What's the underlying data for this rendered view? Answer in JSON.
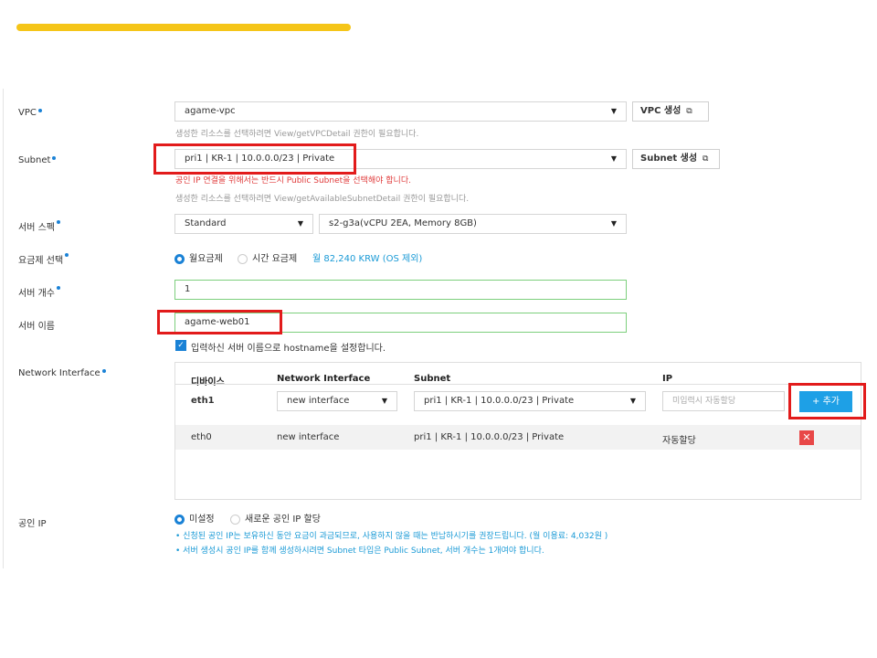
{
  "form": {
    "vpc": {
      "label": "VPC",
      "value": "agame-vpc",
      "button": "VPC 생성",
      "hint": "생성한 리소스를 선택하려면 View/getVPCDetail 권한이 필요합니다."
    },
    "subnet": {
      "label": "Subnet",
      "value": "pri1 | KR-1 | 10.0.0.0/23 | Private",
      "button": "Subnet 생성",
      "error": "공인 IP 연결을 위해서는 반드시 Public Subnet을 선택해야 합니다.",
      "hint": "생성한 리소스를 선택하려면 View/getAvailableSubnetDetail 권한이 필요합니다."
    },
    "spec": {
      "label": "서버 스펙",
      "type_value": "Standard",
      "size_value": "s2-g3a(vCPU 2EA, Memory 8GB)"
    },
    "billing": {
      "label": "요금제 선택",
      "monthly": "월요금제",
      "hourly": "시간 요금제",
      "price": "월 82,240 KRW (OS 제외)"
    },
    "count": {
      "label": "서버 개수",
      "value": "1"
    },
    "name": {
      "label": "서버 이름",
      "value": "agame-web01",
      "checkbox_text": "입력하신 서버 이름으로 hostname을 설정합니다."
    },
    "nic": {
      "label": "Network Interface",
      "headers": [
        "디바이스",
        "Network Interface",
        "Subnet",
        "IP"
      ],
      "new_row": {
        "device": "eth1",
        "interface": "new interface",
        "subnet": "pri1 | KR-1 | 10.0.0.0/23 | Private",
        "ip_placeholder": "미입력시 자동할당",
        "add_button": "+ 추가"
      },
      "rows": [
        {
          "device": "eth0",
          "interface": "new interface",
          "subnet": "pri1 | KR-1 | 10.0.0.0/23 | Private",
          "ip": "자동할당"
        }
      ]
    },
    "public_ip": {
      "label": "공인 IP",
      "opt_none": "미설정",
      "opt_new": "새로운 공인 IP 할당",
      "note1": "신청된 공인 IP는 보유하신 동안 요금이 과금되므로, 사용하지 않을 때는 반납하시기를 권장드립니다. (월 이용료: 4,032원 )",
      "note2": "서버 생성시 공인 IP를 함께 생성하시려면 Subnet 타입은 Public Subnet, 서버 개수는 1개여야 합니다."
    }
  },
  "colors": {
    "accent": "#1a82d6",
    "highlight": "#e21b1b",
    "topbar": "#f5c518",
    "add_button": "#1ea0e6"
  }
}
